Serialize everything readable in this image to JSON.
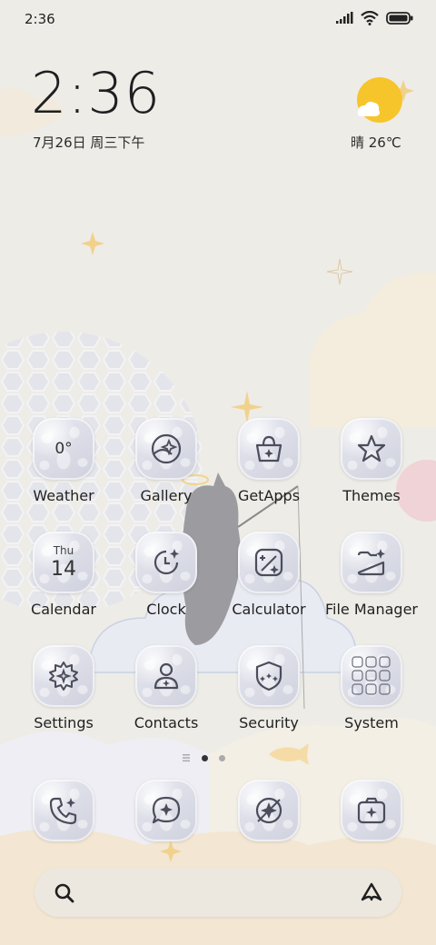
{
  "status_bar": {
    "time": "2:36",
    "icons": [
      "signal-icon",
      "wifi-icon",
      "battery-icon"
    ]
  },
  "clock_widget": {
    "time": "2:36",
    "date": "7月26日 周三下午"
  },
  "weather_widget": {
    "condition_icon": "sun-cloud-icon",
    "text": "晴 26℃"
  },
  "apps": [
    {
      "label": "Weather",
      "icon": "weather-icon",
      "value": "0°"
    },
    {
      "label": "Gallery",
      "icon": "gallery-icon"
    },
    {
      "label": "GetApps",
      "icon": "getapps-icon"
    },
    {
      "label": "Themes",
      "icon": "themes-icon"
    },
    {
      "label": "Calendar",
      "icon": "calendar-icon",
      "day": "Thu",
      "date": "14"
    },
    {
      "label": "Clock",
      "icon": "clock-icon"
    },
    {
      "label": "Calculator",
      "icon": "calculator-icon"
    },
    {
      "label": "File Manager",
      "icon": "file-manager-icon"
    },
    {
      "label": "Settings",
      "icon": "settings-icon"
    },
    {
      "label": "Contacts",
      "icon": "contacts-icon"
    },
    {
      "label": "Security",
      "icon": "security-icon"
    },
    {
      "label": "System",
      "icon": "system-folder-icon"
    }
  ],
  "page_indicator": {
    "pages": 2,
    "current": 1,
    "has_feed": true
  },
  "dock": [
    {
      "icon": "phone-icon"
    },
    {
      "icon": "messages-icon"
    },
    {
      "icon": "browser-icon"
    },
    {
      "icon": "camera-icon"
    }
  ],
  "search_bar": {
    "left_icon": "search-icon",
    "right_icon": "assistant-icon"
  },
  "colors": {
    "wallpaper": "#eeece7",
    "icon_bg": "#d8dae4",
    "icon_stroke": "#4b4d5c",
    "sun": "#f6c52b"
  }
}
